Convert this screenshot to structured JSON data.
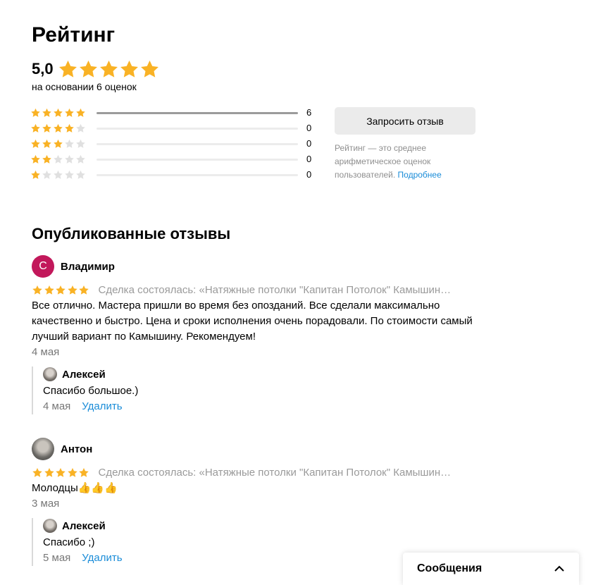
{
  "rating": {
    "title": "Рейтинг",
    "score": "5,0",
    "basis": "на основании 6 оценок",
    "distribution": [
      {
        "stars": 5,
        "count": "6",
        "fraction": 1.0
      },
      {
        "stars": 4,
        "count": "0",
        "fraction": 0
      },
      {
        "stars": 3,
        "count": "0",
        "fraction": 0
      },
      {
        "stars": 2,
        "count": "0",
        "fraction": 0
      },
      {
        "stars": 1,
        "count": "0",
        "fraction": 0
      }
    ],
    "request_button": "Запросить отзыв",
    "note": "Рейтинг — это среднее арифметическое оценок пользователей.",
    "note_link": "Подробнее"
  },
  "colors": {
    "star_filled": "#f9b225",
    "star_empty": "#e0e0e0",
    "link": "#1a8cd8"
  },
  "reviews": {
    "title": "Опубликованные отзывы",
    "items": [
      {
        "avatar_letter": "С",
        "author": "Владимир",
        "stars": 5,
        "deal": "Сделка состоялась: «Натяжные потолки \"Капитан Потолок\" Камышин…",
        "text": "Все отлично. Мастера пришли во время без опозданий. Все сделали максимально качественно и быстро. Цена и сроки исполнения очень порадовали. По стоимости самый лучший вариант по Камышину. Рекомендуем!",
        "date": "4 мая",
        "reply": {
          "author": "Алексей",
          "text": "Спасибо большое.)",
          "date": "4 мая",
          "delete": "Удалить"
        }
      },
      {
        "avatar_letter": "",
        "author": "Антон",
        "stars": 5,
        "deal": "Сделка состоялась: «Натяжные потолки \"Капитан Потолок\" Камышин…",
        "text": "Молодцы👍👍👍",
        "date": "3 мая",
        "reply": {
          "author": "Алексей",
          "text": "Спасибо ;)",
          "date": "5 мая",
          "delete": "Удалить"
        }
      }
    ]
  },
  "messages": {
    "label": "Сообщения"
  }
}
